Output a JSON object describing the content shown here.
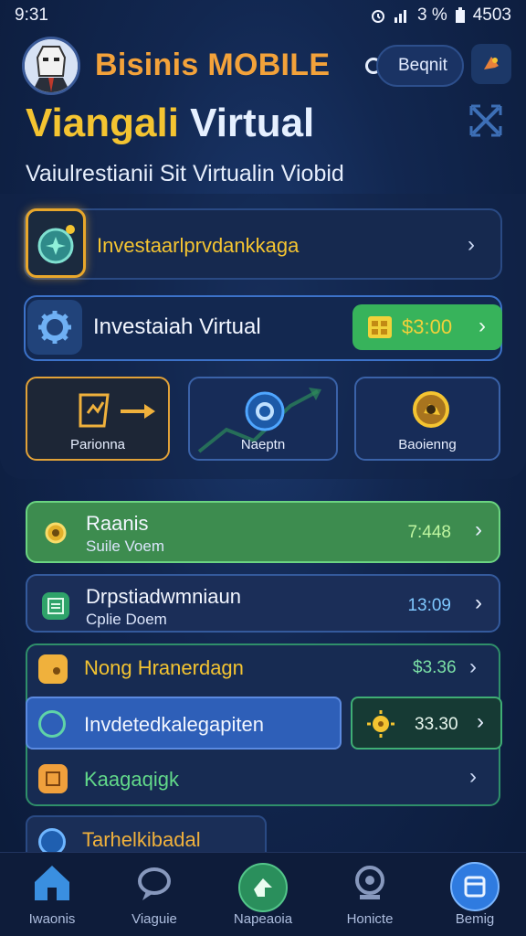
{
  "status_bar": {
    "time": "9:31",
    "battery": "3 %",
    "signal_text": "4503"
  },
  "header": {
    "brand": "Bisinis MOBILE",
    "begin_button": "Beqnit",
    "headline_part1": "Viangali",
    "headline_part2": "Virtual",
    "subtitle": "Vaiulrestianii Sit Virtualin Viobid"
  },
  "primary_rows": [
    {
      "label": "Investaarlprvdankkaga"
    },
    {
      "label": "Investaiah Virtual",
      "price": "$3:00"
    }
  ],
  "tiles": [
    {
      "label": "Parionna"
    },
    {
      "label": "Naeptn"
    },
    {
      "label": "Baoienng"
    }
  ],
  "list": [
    {
      "title": "Raanis",
      "subtitle": "Suile Voem",
      "value": "7:448"
    },
    {
      "title": "Drpstiadwmniaun",
      "subtitle": "Cplie Doem",
      "value": "13:09"
    }
  ],
  "group": {
    "row1": {
      "title": "Nong Hranerdagn",
      "value": "$3.36"
    },
    "row2": {
      "title": "Invdetedkalegapiten",
      "value": "33.30"
    },
    "row3": {
      "title": "Kaagaqigk"
    }
  },
  "partial": {
    "title": "Tarhelkibadal"
  },
  "bottom_nav": [
    {
      "label": "Iwaonis"
    },
    {
      "label": "Viaguie"
    },
    {
      "label": "Napeaoia"
    },
    {
      "label": "Honicte"
    },
    {
      "label": "Bemig"
    }
  ],
  "colors": {
    "accent_gold": "#f4c431",
    "accent_green": "#37b35b",
    "accent_blue": "#2e5fb8",
    "background": "#122750"
  }
}
